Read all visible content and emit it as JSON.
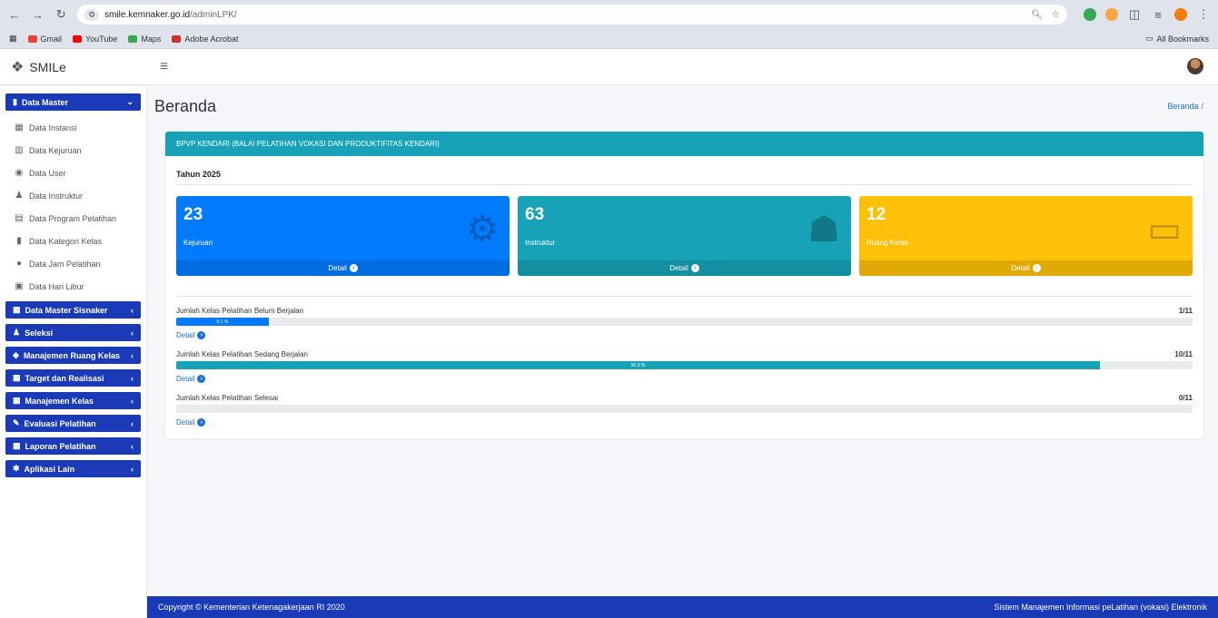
{
  "browser": {
    "url_host": "smile.kemnaker.go.id",
    "url_path": "/adminLPK/",
    "bookmarks": [
      "Gmail",
      "YouTube",
      "Maps",
      "Adobe Acrobat"
    ],
    "all_bookmarks": "All Bookmarks"
  },
  "header": {
    "brand": "SMILe"
  },
  "sidebar": {
    "data_master": "Data Master",
    "items": [
      {
        "label": "Data Instansi",
        "icon": "building-icon",
        "glyph": "▦"
      },
      {
        "label": "Data Kejuruan",
        "icon": "chart-icon",
        "glyph": "▥"
      },
      {
        "label": "Data User",
        "icon": "user-circle-icon",
        "glyph": "◉"
      },
      {
        "label": "Data Instruktur",
        "icon": "instructor-icon",
        "glyph": "♟"
      },
      {
        "label": "Data Program Pelatihan",
        "icon": "trash-icon",
        "glyph": "▤"
      },
      {
        "label": "Data Kategori Kelas",
        "icon": "book-icon",
        "glyph": "▮"
      },
      {
        "label": "Data Jam Pelatihan",
        "icon": "clock-icon",
        "glyph": "●"
      },
      {
        "label": "Data Hari Libur",
        "icon": "calendar-icon",
        "glyph": "▣"
      }
    ],
    "menus": [
      {
        "label": "Data Master Sisnaker",
        "glyph": "▦"
      },
      {
        "label": "Seleksi",
        "glyph": "♟"
      },
      {
        "label": "Manajemen Ruang Kelas",
        "glyph": "◈"
      },
      {
        "label": "Target dan Realisasi",
        "glyph": "▦"
      },
      {
        "label": "Manajemen Kelas",
        "glyph": "▦"
      },
      {
        "label": "Evaluasi Pelatihan",
        "glyph": "✎"
      },
      {
        "label": "Laporan Pelatihan",
        "glyph": "▦"
      },
      {
        "label": "Aplikasi Lain",
        "glyph": "✱"
      }
    ]
  },
  "main": {
    "title": "Beranda",
    "breadcrumb": "Beranda",
    "breadcrumb_sep": "/",
    "card_title": "BPVP KENDARI (BALAI PELATIHAN VOKASI DAN PRODUKTIFITAS KENDARI)",
    "year": "Tahun 2025",
    "boxes": [
      {
        "value": "23",
        "label": "Kejuruan",
        "footer": "Detail",
        "color": "#007bff",
        "icon": "gears-icon"
      },
      {
        "value": "63",
        "label": "Instruktur",
        "footer": "Detail",
        "color": "#17a2b8",
        "icon": "user-tie-icon"
      },
      {
        "value": "12",
        "label": "Ruang Kelas",
        "footer": "Detail",
        "color": "#ffc107",
        "icon": "chalkboard-teacher-icon"
      }
    ],
    "progress": [
      {
        "label": "Jumlah Kelas Pelatihan Belum Berjalan",
        "count": "1/11",
        "percent_text": "9.1 %",
        "percent": 9.1,
        "color": "#007bff",
        "detail": "Detail"
      },
      {
        "label": "Jumlah Kelas Pelatihan Sedang Berjalan",
        "count": "10/11",
        "percent_text": "90.9 %",
        "percent": 90.9,
        "color": "#17a2b8",
        "detail": "Detail"
      },
      {
        "label": "Jumlah Kelas Pelatihan Selesai",
        "count": "0/11",
        "percent_text": "",
        "percent": 0,
        "color": "#28a745",
        "detail": "Detail"
      }
    ]
  },
  "footer": {
    "left": "Copyright © Kementerian Ketenagakerjaan RI 2020",
    "right": "Sistem Manajemen Informasi peLatihan (vokasi) Elektronik"
  }
}
